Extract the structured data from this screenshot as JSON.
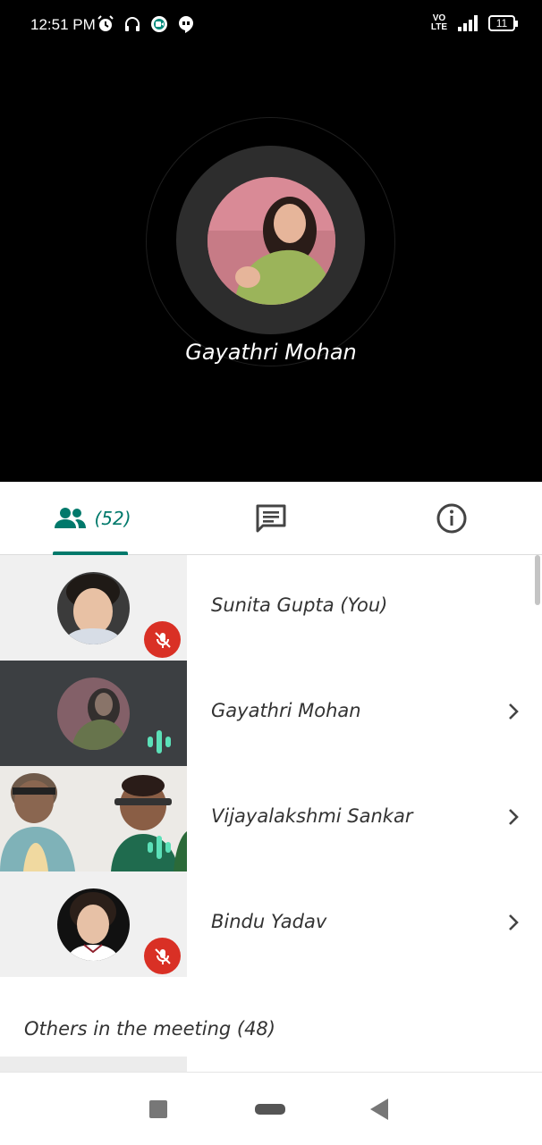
{
  "status_bar": {
    "time": "12:51 PM",
    "network_top": "VO",
    "network_bottom": "LTE",
    "battery": "11",
    "icons": [
      "alarm-icon",
      "headset-icon",
      "meet-icon",
      "hangouts-icon"
    ]
  },
  "active_speaker": {
    "name": "Gayathri Mohan"
  },
  "tabs": {
    "people_count": "(52)",
    "icons": [
      "people-icon",
      "chat-icon",
      "info-icon"
    ],
    "accent": "#00796b"
  },
  "participants": [
    {
      "name": "Sunita Gupta (You)",
      "state": "muted",
      "has_chevron": false
    },
    {
      "name": "Gayathri Mohan",
      "state": "speaking",
      "has_chevron": true
    },
    {
      "name": "Vijayalakshmi Sankar",
      "state": "speaking",
      "has_chevron": true
    },
    {
      "name": "Bindu Yadav",
      "state": "muted",
      "has_chevron": true
    }
  ],
  "others_label": "Others in the meeting (48)",
  "colors": {
    "mute_badge": "#d93025",
    "speaking_bars": "#5ce0b8"
  },
  "nav_bar": [
    "recents-icon",
    "home-icon",
    "back-icon"
  ]
}
